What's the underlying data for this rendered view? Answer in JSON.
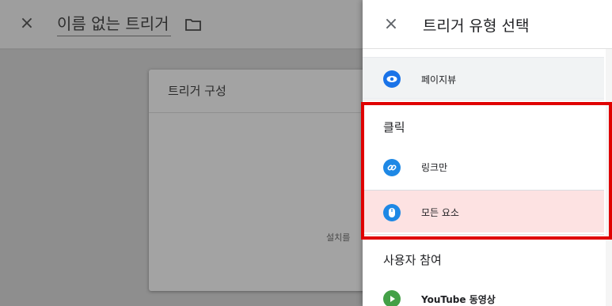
{
  "background": {
    "close_glyph": "×",
    "trigger_name": "이름 없는 트리거",
    "card_title": "트리거 구성",
    "card_hint": "설치를"
  },
  "panel": {
    "close_glyph": "×",
    "title": "트리거 유형 선택",
    "items": {
      "pageview": {
        "label": "페이지뷰",
        "icon": "eye-icon"
      },
      "link_only": {
        "label": "링크만",
        "icon": "link-icon"
      },
      "all_elements": {
        "label": "모든 요소",
        "icon": "mouse-icon"
      },
      "youtube": {
        "label": "YouTube 동영상",
        "icon": "play-icon"
      }
    },
    "sections": {
      "click": "클릭",
      "user_engagement": "사용자 참여"
    }
  },
  "colors": {
    "highlight": "#e00000",
    "selected_row": "#fde2e2",
    "blue_icon": "#1e88e5",
    "green_icon": "#43a047"
  }
}
